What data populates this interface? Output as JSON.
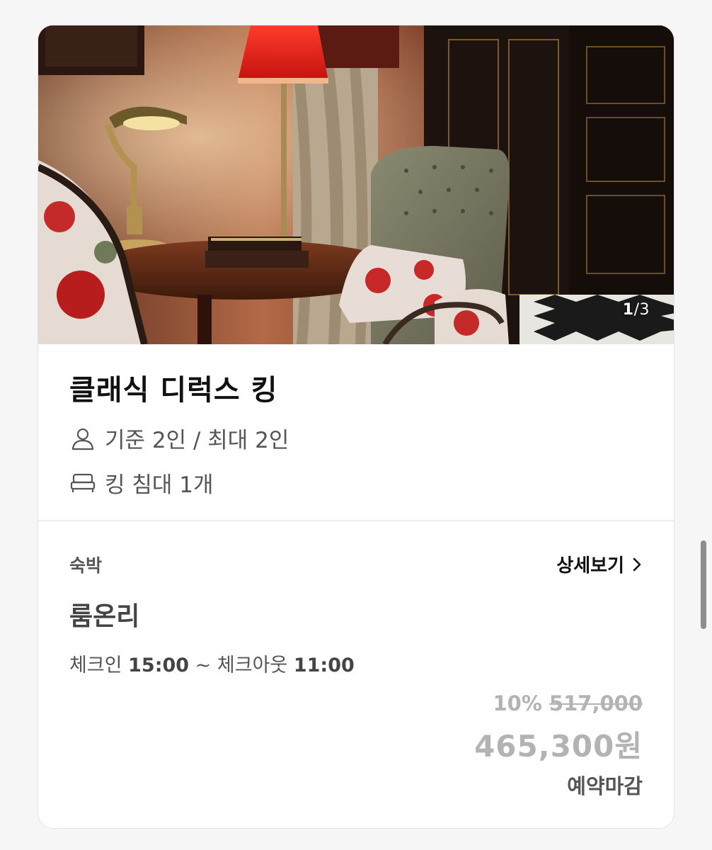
{
  "room": {
    "image_counter": {
      "current": "1",
      "separator": "/",
      "total": "3"
    },
    "title": "클래식 디럭스 킹",
    "capacity": "기준 2인 / 최대 2인",
    "bed": "킹 침대 1개",
    "capacity_icon": "person-icon",
    "bed_icon": "bed-icon"
  },
  "plan": {
    "type": "숙박",
    "detail_label": "상세보기",
    "name": "룸온리",
    "checkin_label": "체크인",
    "checkin_time": "15:00",
    "tilde": "~",
    "checkout_label": "체크아웃",
    "checkout_time": "11:00",
    "discount_percent": "10%",
    "original_price": "517,000",
    "final_price": "465,300원",
    "status": "예약마감"
  },
  "colors": {
    "muted_price": "#b3b3b3",
    "text_secondary": "#555555",
    "card_bg": "#ffffff",
    "page_bg": "#f6f6f6"
  }
}
